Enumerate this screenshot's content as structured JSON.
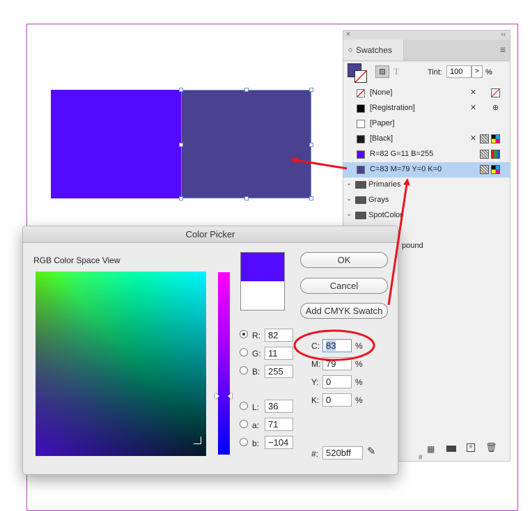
{
  "canvas": {
    "rect_left_color": "#520bff",
    "rect_right_color": "#4a4190"
  },
  "swatches": {
    "close_glyph": "×",
    "collapse_glyph": "‹‹",
    "tab_label": "Swatches",
    "tab_arrows": "◇",
    "menu_glyph": "≡",
    "text_glyph": "T",
    "tint_label": "Tint:",
    "tint_value": "100",
    "tint_arrow": ">",
    "tint_unit": "%",
    "items": [
      {
        "name": "[None]",
        "color": "none"
      },
      {
        "name": "[Registration]",
        "color": "#000000"
      },
      {
        "name": "[Paper]",
        "color": "#ffffff"
      },
      {
        "name": "[Black]",
        "color": "#1a1a1a"
      },
      {
        "name": "R=82 G=11 B=255",
        "color": "#520bff"
      },
      {
        "name": "C=83 M=79 Y=0 K=0",
        "color": "#4a4190"
      }
    ],
    "groups": [
      {
        "name": "Primaries"
      },
      {
        "name": "Grays"
      },
      {
        "name": "SpotColor"
      },
      {
        "name": "..."
      },
      {
        "name": "Compound"
      }
    ],
    "group_partial_1": "",
    "compound_partial": "pound",
    "grip": "||||||||"
  },
  "picker": {
    "title": "Color Picker",
    "space_label": "RGB Color Space View",
    "ok_label": "OK",
    "cancel_label": "Cancel",
    "add_label": "Add CMYK Swatch",
    "new_color": "#520bff",
    "old_color": "#ffffff",
    "r_label": "R:",
    "r_value": "82",
    "g_label": "G:",
    "g_value": "11",
    "b_label": "B:",
    "b_value": "255",
    "l_label": "L:",
    "l_value": "36",
    "a_label": "a:",
    "a_value": "71",
    "bb_label": "b:",
    "bb_value": "−104",
    "c_label": "C:",
    "c_value": "83",
    "m_label": "M:",
    "m_value": "79",
    "y_label": "Y:",
    "y_value": "0",
    "k_label": "K:",
    "k_value": "0",
    "pct": "%",
    "hex_label": "#:",
    "hex_value": "520bff"
  }
}
